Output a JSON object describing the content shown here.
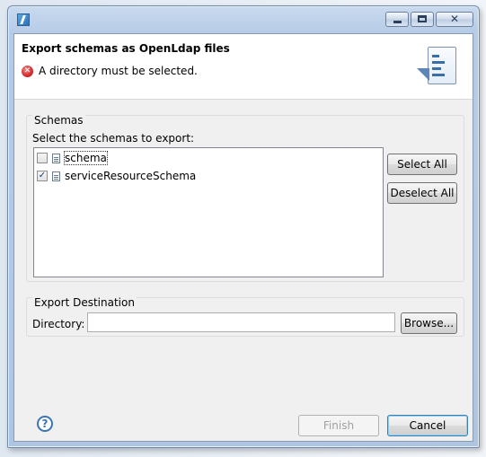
{
  "dialog": {
    "title": "Export schemas as OpenLdap files",
    "error_message": "A directory must be selected."
  },
  "schemas_group": {
    "label": "Schemas",
    "instruction": "Select the schemas to export:",
    "items": [
      {
        "label": "schema",
        "checked": false
      },
      {
        "label": "serviceResourceSchema",
        "checked": true
      }
    ],
    "select_all_label": "Select All",
    "deselect_all_label": "Deselect All"
  },
  "destination_group": {
    "label": "Export Destination",
    "directory_label": "Directory:",
    "directory_value": "",
    "browse_label": "Browse..."
  },
  "footer": {
    "finish_label": "Finish",
    "cancel_label": "Cancel"
  },
  "colors": {
    "error": "#d52b2b",
    "accent": "#3a74b7"
  }
}
